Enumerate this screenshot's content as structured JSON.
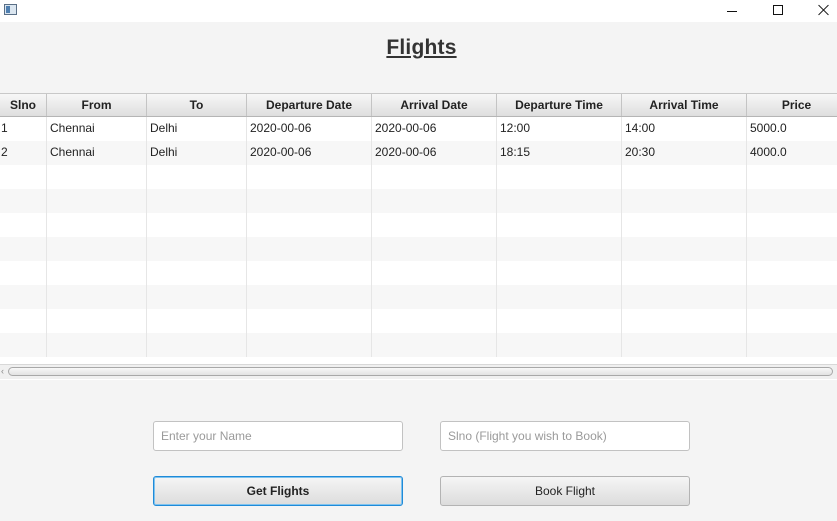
{
  "window": {
    "min_icon": "minimize-icon",
    "max_icon": "maximize-icon",
    "close_icon": "close-icon"
  },
  "heading": "Flights",
  "table": {
    "columns": [
      "Slno",
      "From",
      "To",
      "Departure Date",
      "Arrival Date",
      "Departure Time",
      "Arrival Time",
      "Price"
    ],
    "rows": [
      [
        "1",
        "Chennai",
        "Delhi",
        "2020-00-06",
        "2020-00-06",
        "12:00",
        "14:00",
        "5000.0"
      ],
      [
        "2",
        "Chennai",
        "Delhi",
        "2020-00-06",
        "2020-00-06",
        "18:15",
        "20:30",
        "4000.0"
      ]
    ]
  },
  "form": {
    "name_placeholder": "Enter your Name",
    "slno_placeholder": "Slno (Flight you wish to Book)",
    "get_flights_label": "Get Flights",
    "book_flight_label": "Book Flight"
  },
  "colors": {
    "focus_border": "#1f8ad8"
  }
}
